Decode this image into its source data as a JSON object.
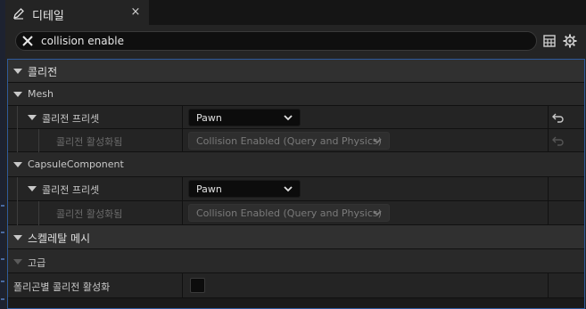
{
  "tab": {
    "title": "디테일",
    "close": "×",
    "icon": "pencil-icon"
  },
  "search": {
    "value": "collision enable",
    "clear_icon": "close-icon"
  },
  "toolbar": {
    "table_icon": "table-view-icon",
    "settings_icon": "gear-icon"
  },
  "sections": {
    "collision": {
      "label": "콜리전"
    },
    "mesh": {
      "label": "Mesh",
      "preset_label": "콜리전 프리셋",
      "preset_value": "Pawn",
      "enabled_label": "콜리전 활성화됨",
      "enabled_value": "Collision Enabled (Query and Physics)"
    },
    "capsule": {
      "label": "CapsuleComponent",
      "preset_label": "콜리전 프리셋",
      "preset_value": "Pawn",
      "enabled_label": "콜리전 활성화됨",
      "enabled_value": "Collision Enabled (Query and Physics)"
    },
    "skeletal": {
      "label": "스켈레탈 메시"
    },
    "advanced": {
      "label": "고급",
      "per_poly_label": "폴리곤별 콜리전 활성화",
      "per_poly_checked": false
    }
  },
  "colors": {
    "accent_border": "#2e5a9c",
    "background": "#242424"
  }
}
